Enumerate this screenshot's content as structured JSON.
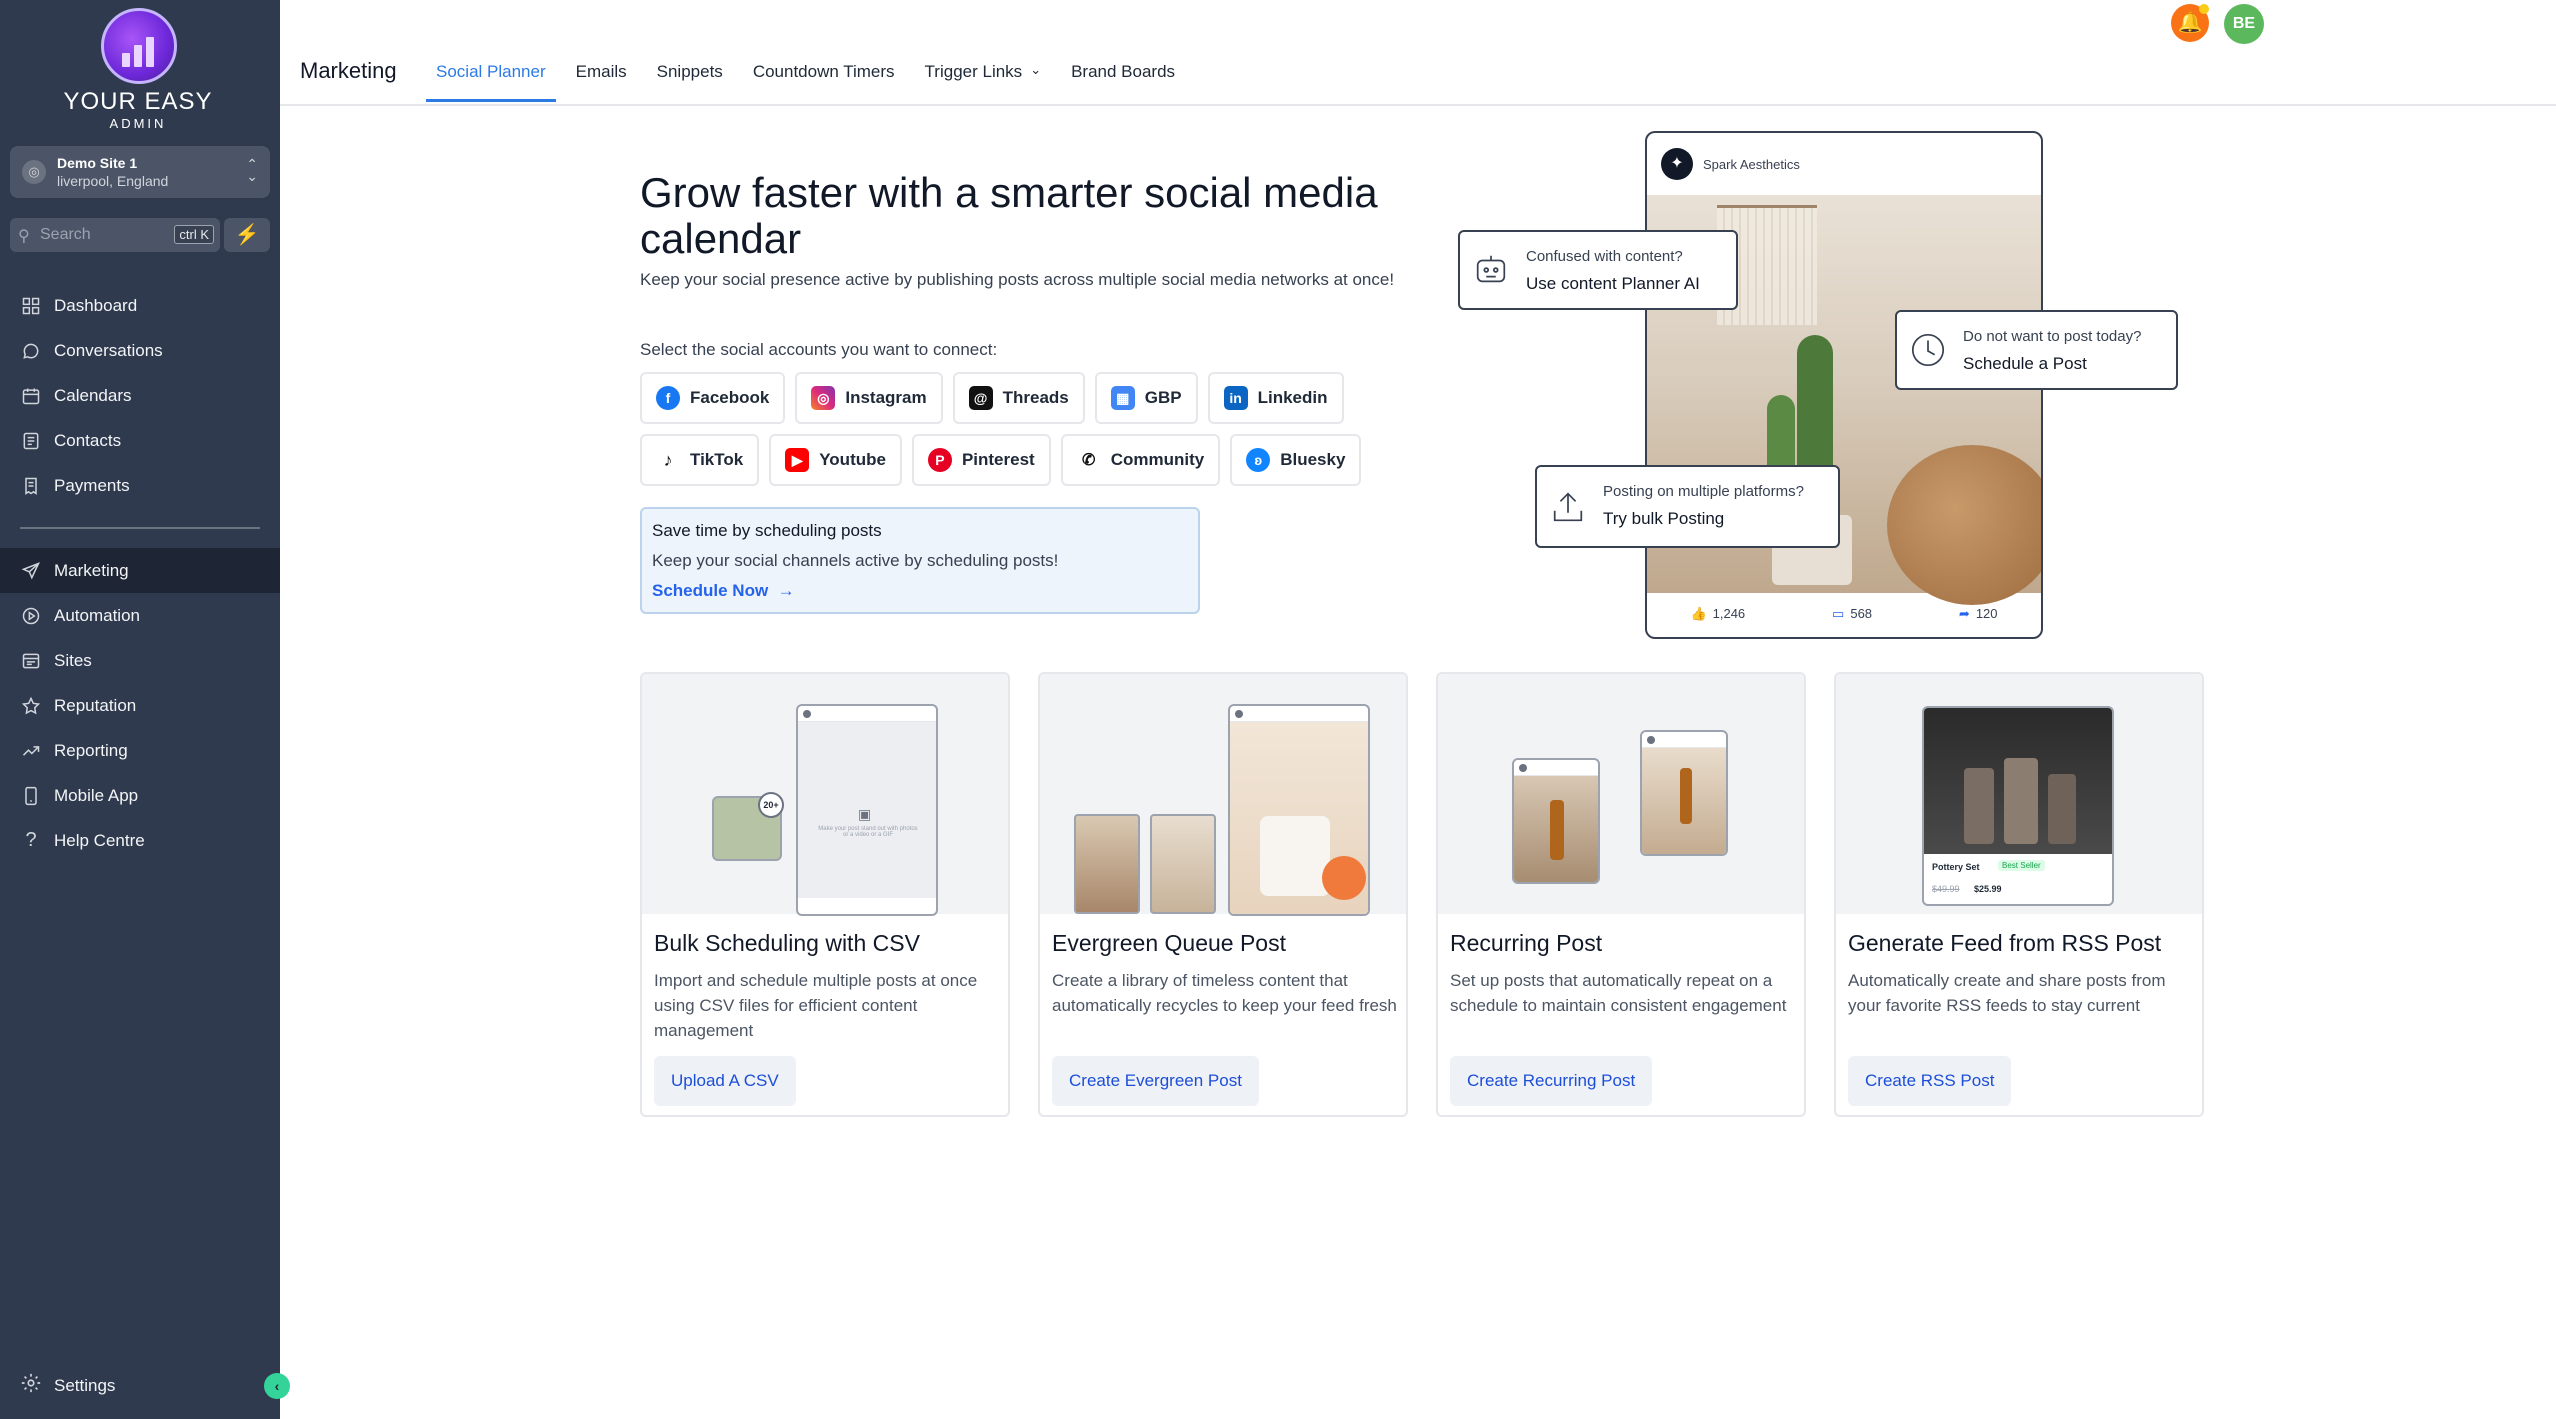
{
  "brand": {
    "line1": "YOUR EASY",
    "line2": "ADMIN"
  },
  "site": {
    "name": "Demo Site 1",
    "location": "liverpool, England"
  },
  "search": {
    "placeholder": "Search",
    "shortcut": "ctrl K"
  },
  "nav": {
    "primary": [
      {
        "label": "Dashboard",
        "icon": "grid-icon"
      },
      {
        "label": "Conversations",
        "icon": "chat-icon"
      },
      {
        "label": "Calendars",
        "icon": "calendar-icon"
      },
      {
        "label": "Contacts",
        "icon": "contacts-icon"
      },
      {
        "label": "Payments",
        "icon": "receipt-icon"
      }
    ],
    "secondary": [
      {
        "label": "Marketing",
        "icon": "send-icon",
        "active": true
      },
      {
        "label": "Automation",
        "icon": "automation-icon"
      },
      {
        "label": "Sites",
        "icon": "sites-icon"
      },
      {
        "label": "Reputation",
        "icon": "star-icon"
      },
      {
        "label": "Reporting",
        "icon": "trend-icon"
      },
      {
        "label": "Mobile App",
        "icon": "mobile-icon"
      },
      {
        "label": "Help Centre",
        "icon": "help-icon"
      }
    ],
    "settings": "Settings"
  },
  "header": {
    "title": "Marketing",
    "tabs": [
      {
        "label": "Social Planner",
        "active": true
      },
      {
        "label": "Emails"
      },
      {
        "label": "Snippets"
      },
      {
        "label": "Countdown Timers"
      },
      {
        "label": "Trigger Links",
        "dropdown": true
      },
      {
        "label": "Brand Boards"
      }
    ],
    "user_initials": "BE"
  },
  "hero": {
    "title": "Grow faster with a smarter social media calendar",
    "subtitle": "Keep your social presence active by publishing posts across multiple social media networks at once!",
    "connect_label": "Select the social accounts you want to connect:",
    "accounts_row1": [
      "Facebook",
      "Instagram",
      "Threads",
      "GBP",
      "Linkedin"
    ],
    "accounts_row2": [
      "TikTok",
      "Youtube",
      "Pinterest",
      "Community",
      "Bluesky"
    ]
  },
  "schedule_box": {
    "title": "Save time by scheduling posts",
    "description": "Keep your social channels active by scheduling posts!",
    "link": "Schedule Now"
  },
  "illustration": {
    "account": "Spark Aesthetics",
    "likes": "1,246",
    "comments": "568",
    "shares": "120",
    "callout1": {
      "question": "Confused with content?",
      "action": "Use content Planner AI"
    },
    "callout2": {
      "question": "Do not want to post today?",
      "action": "Schedule a Post"
    },
    "callout3": {
      "question": "Posting on multiple platforms?",
      "action": "Try bulk Posting"
    }
  },
  "cards": [
    {
      "title": "Bulk Scheduling with CSV",
      "description": "Import and schedule multiple posts at once using CSV files for efficient content management",
      "button": "Upload A CSV"
    },
    {
      "title": "Evergreen Queue Post",
      "description": "Create a library of timeless content that automatically recycles to keep your feed fresh",
      "button": "Create Evergreen Post"
    },
    {
      "title": "Recurring Post",
      "description": "Set up posts that automatically repeat on a schedule to maintain consistent engagement",
      "button": "Create Recurring Post"
    },
    {
      "title": "Generate Feed from RSS Post",
      "description": "Automatically create and share posts from your favorite RSS feeds to stay current",
      "button": "Create RSS Post"
    }
  ],
  "card_thumbs": {
    "bulk_badge": "20+",
    "bulk_text": "Make your post stand out with photos or a video or a GIF",
    "rss_product": "Pottery Set",
    "rss_badge": "Best Seller",
    "rss_old_price": "$49.99",
    "rss_price": "$25.99"
  },
  "colors": {
    "sidebar": "#2f3a4e",
    "accent": "#2c7be5",
    "link": "#2563eb",
    "bell": "#f97316",
    "avatar": "#5cb85c"
  }
}
